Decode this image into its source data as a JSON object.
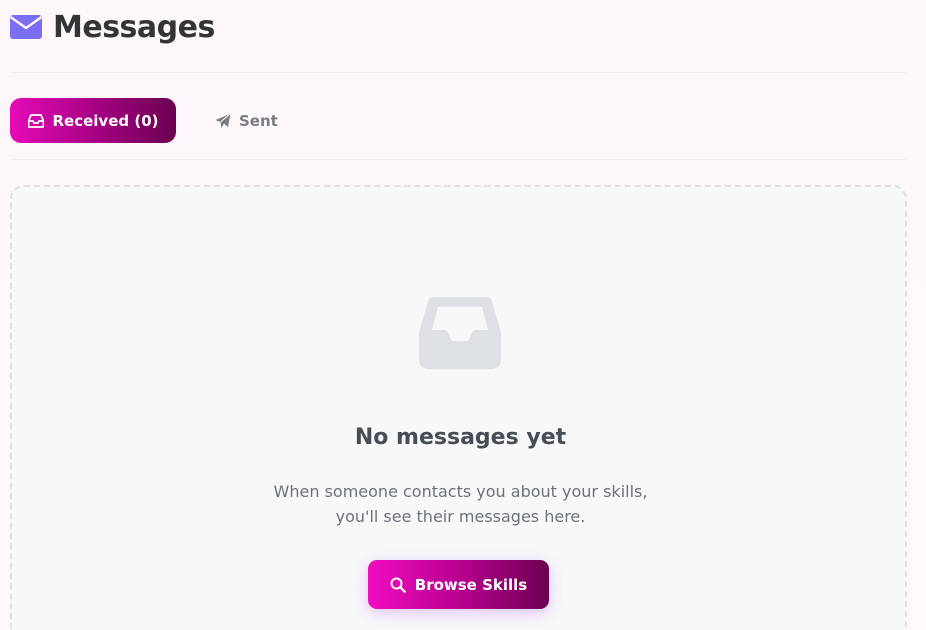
{
  "header": {
    "title": "Messages",
    "icon": "envelope-icon",
    "icon_color": "#7c6ef2"
  },
  "tabs": [
    {
      "label": "Received (0)",
      "icon": "inbox-icon",
      "active": true
    },
    {
      "label": "Sent",
      "icon": "paper-plane-icon",
      "active": false
    }
  ],
  "empty_state": {
    "icon": "inbox-icon",
    "title": "No messages yet",
    "description_line1": "When someone contacts you about your skills,",
    "description_line2": "you'll see their messages here.",
    "button_label": "Browse Skills",
    "button_icon": "search-icon"
  },
  "colors": {
    "accent_start": "#e50bb7",
    "accent_end": "#6a0050",
    "muted_text": "#7a7c83"
  }
}
